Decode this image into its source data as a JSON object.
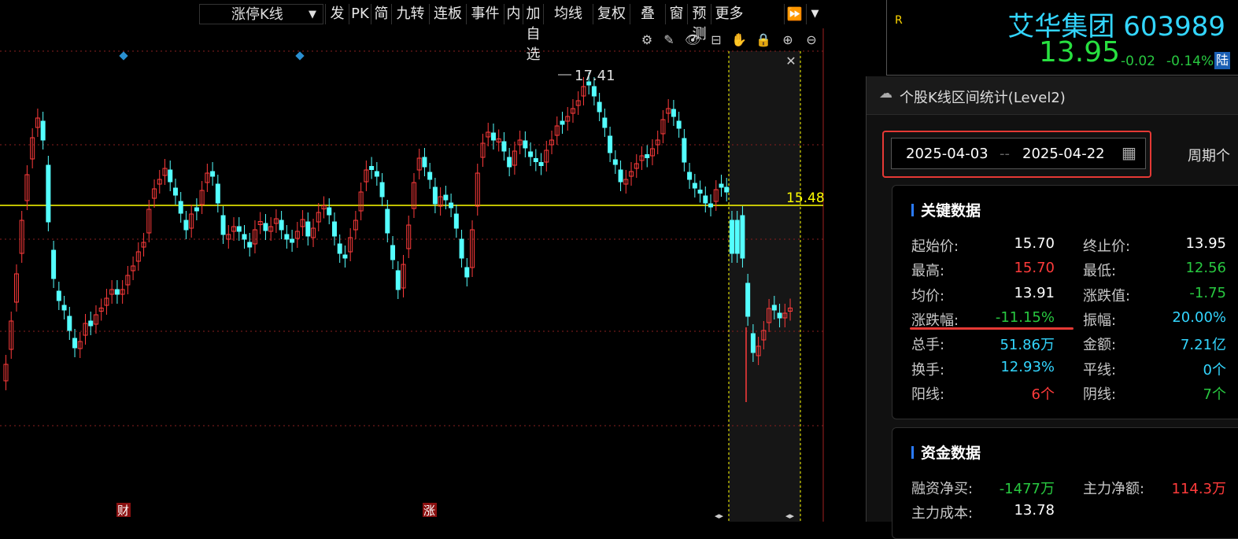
{
  "toolbar": {
    "dropdown_label": "涨停K线",
    "buttons": [
      "发",
      "PK",
      "简",
      "九转",
      "连板",
      "事件",
      "内",
      "加自选",
      "均线",
      "复权",
      "叠",
      "窗",
      "预测",
      "更多"
    ]
  },
  "chart": {
    "price_axis": [
      "17.76",
      "16.38",
      "14.98",
      "13.60",
      "12.21"
    ],
    "horizontal_line_label": "15.48",
    "peak_label": "17.41",
    "bottom_markers": [
      "财",
      "涨"
    ],
    "colors": {
      "up": "#ff3b3b",
      "down": "#54ffff",
      "hline": "#ffff00",
      "axis": "#ff3b3b"
    }
  },
  "quote": {
    "name": "艾华集团",
    "code": "603989",
    "price": "13.95",
    "change": "-0.02",
    "change_pct": "-0.14%",
    "market_badge": "陆",
    "corner_tag": "R"
  },
  "panel": {
    "title": "个股K线区间统计(Level2)",
    "date_start": "2025-04-03",
    "date_sep": "--",
    "date_end": "2025-04-22",
    "period_label": "周期个",
    "key_section": {
      "title": "关键数据",
      "rows": [
        {
          "l1": "起始价:",
          "v1": "15.70",
          "c1": "w",
          "l2": "终止价:",
          "v2": "13.95",
          "c2": "w"
        },
        {
          "l1": "最高:",
          "v1": "15.70",
          "c1": "r",
          "l2": "最低:",
          "v2": "12.56",
          "c2": "g"
        },
        {
          "l1": "均价:",
          "v1": "13.91",
          "c1": "w",
          "l2": "涨跌值:",
          "v2": "-1.75",
          "c2": "g"
        },
        {
          "l1": "涨跌幅:",
          "v1": "-11.15%",
          "c1": "g",
          "l2": "振幅:",
          "v2": "20.00%",
          "c2": "c"
        },
        {
          "l1": "总手:",
          "v1": "51.86万",
          "c1": "c",
          "l2": "金额:",
          "v2": "7.21亿",
          "c2": "c"
        },
        {
          "l1": "换手:",
          "v1": "12.93%",
          "c1": "c",
          "l2": "平线:",
          "v2": "0个",
          "c2": "c"
        },
        {
          "l1": "阳线:",
          "v1": "6个",
          "c1": "r",
          "l2": "阴线:",
          "v2": "7个",
          "c2": "g"
        }
      ]
    },
    "fund_section": {
      "title": "资金数据",
      "rows": [
        {
          "l1": "融资净买:",
          "v1": "-1477万",
          "c1": "g",
          "l2": "主力净额:",
          "v2": "114.3万",
          "c2": "r"
        },
        {
          "l1": "主力成本:",
          "v1": "13.78",
          "c1": "w",
          "l2": "",
          "v2": "",
          "c2": "w"
        }
      ]
    }
  }
}
